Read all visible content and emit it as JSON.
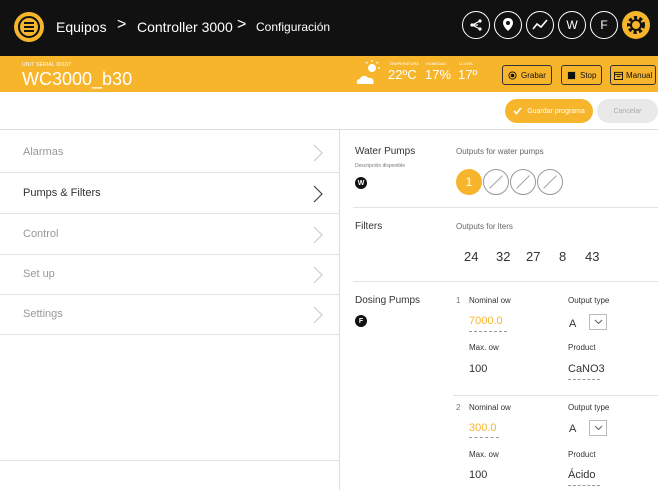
{
  "nav": {
    "breadcrumbs": [
      "Equipos",
      "Controller 3000",
      "Configuración"
    ],
    "icons": [
      "share-icon",
      "location-icon",
      "chart-icon",
      "w-icon",
      "f-icon",
      "settings-icon"
    ],
    "icon_letters": {
      "w": "W",
      "f": "F"
    },
    "accent": "#f7b52c"
  },
  "unit": {
    "serial_label": "UNIT SERIAL 00107",
    "name": "WC3000_b30"
  },
  "weather": {
    "temp_label": "TEMPERATURA",
    "temp_value": "22ºC",
    "humidity_label": "HUMEDAD",
    "humidity_value": "17%",
    "rain_label": "LLUVIA",
    "rain_value": "17º"
  },
  "actions": {
    "record": "Grabar",
    "stop": "Stop",
    "manual": "Manual"
  },
  "save_bar": {
    "save": "Guardar programa",
    "cancel": "Cancelar"
  },
  "sidebar": {
    "items": [
      {
        "label": "Alarmas",
        "active": false
      },
      {
        "label": "Pumps & Filters",
        "active": true
      },
      {
        "label": "Control",
        "active": false
      },
      {
        "label": "Set up",
        "active": false
      },
      {
        "label": "Settings",
        "active": false
      }
    ]
  },
  "water_pumps": {
    "title": "Water Pumps",
    "desc": "Descripción disponible",
    "badge": "W",
    "outputs_label": "Outputs for water pumps",
    "active_output": "1"
  },
  "filters": {
    "title": "Filters",
    "outputs_label": "Outputs for  lters",
    "values": [
      "24",
      "32",
      "27",
      "8",
      "43"
    ]
  },
  "dosing": {
    "title": "Dosing Pumps",
    "badge": "F",
    "entries": [
      {
        "index": "1",
        "nominal_label": "Nominal  ow",
        "nominal_value": "7000.0",
        "output_label": "Output type",
        "output_value": "A",
        "max_label": "Max.  ow",
        "max_value": "100",
        "product_label": "Product",
        "product_value": "CaNO3"
      },
      {
        "index": "2",
        "nominal_label": "Nominal  ow",
        "nominal_value": "300.0",
        "output_label": "Output type",
        "output_value": "A",
        "max_label": "Max.  ow",
        "max_value": "100",
        "product_label": "Product",
        "product_value": "Ácido"
      }
    ]
  }
}
